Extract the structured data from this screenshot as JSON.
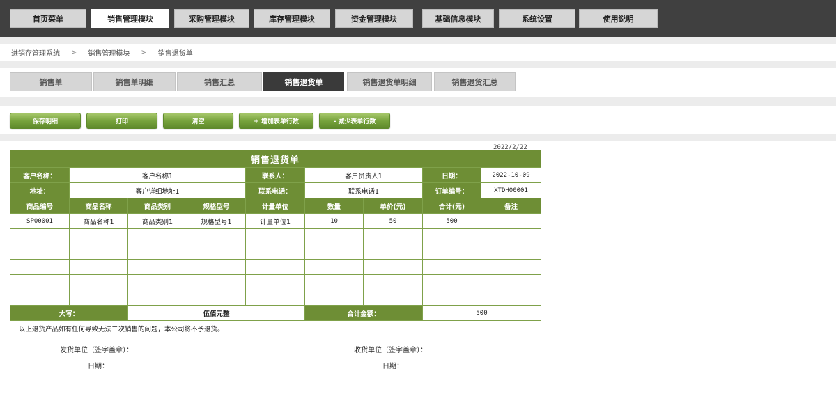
{
  "top_nav": [
    "首页菜单",
    "销售管理模块",
    "采购管理模块",
    "库存管理模块",
    "资金管理模块",
    "基础信息模块",
    "系统设置",
    "使用说明"
  ],
  "breadcrumb": [
    "进销存管理系统",
    "销售管理模块",
    "销售退货单"
  ],
  "breadcrumb_sep": ">",
  "sub_tabs": [
    "销售单",
    "销售单明细",
    "销售汇总",
    "销售退货单",
    "销售退货单明细",
    "销售退货汇总"
  ],
  "active_top": "销售管理模块",
  "active_sub": "销售退货单",
  "buttons": {
    "save": "保存明细",
    "print": "打印",
    "clear": "清空",
    "add_rows": "+ 增加表单行数",
    "remove_rows": "- 减少表单行数"
  },
  "form": {
    "print_date": "2022/2/22",
    "title": "销售退货单",
    "customer_label": "客户名称：",
    "customer": "客户名称1",
    "contact_label": "联系人：",
    "contact": "客户员责人1",
    "date_label": "日期：",
    "date": "2022-10-09",
    "address_label": "地址：",
    "address": "客户详细地址1",
    "phone_label": "联系电话：",
    "phone": "联系电话1",
    "order_label": "订单编号：",
    "order_no": "XTDH00001",
    "columns": [
      "商品编号",
      "商品名称",
      "商品类别",
      "规格型号",
      "计量单位",
      "数量",
      "单价(元)",
      "合计(元)",
      "备注"
    ],
    "rows": [
      [
        "SP00001",
        "商品名称1",
        "商品类别1",
        "规格型号1",
        "计量单位1",
        "10",
        "50",
        "500",
        ""
      ],
      [
        "",
        "",
        "",
        "",
        "",
        "",
        "",
        "",
        ""
      ],
      [
        "",
        "",
        "",
        "",
        "",
        "",
        "",
        "",
        ""
      ],
      [
        "",
        "",
        "",
        "",
        "",
        "",
        "",
        "",
        ""
      ],
      [
        "",
        "",
        "",
        "",
        "",
        "",
        "",
        "",
        ""
      ],
      [
        "",
        "",
        "",
        "",
        "",
        "",
        "",
        "",
        ""
      ]
    ],
    "daxie_label": "大写：",
    "daxie": "伍佰元整",
    "total_label": "合计金额：",
    "total": "500",
    "note": "以上退货产品如有任何导致无法二次销售的问题，本公司将不予退货。",
    "sender_label": "发货单位（签字盖章）：",
    "receiver_label": "收货单位（签字盖章）：",
    "sign_date_label": "日期："
  },
  "colors": {
    "green": "#6e8e35",
    "button_green": "#74a03a",
    "topbar": "#404040"
  }
}
